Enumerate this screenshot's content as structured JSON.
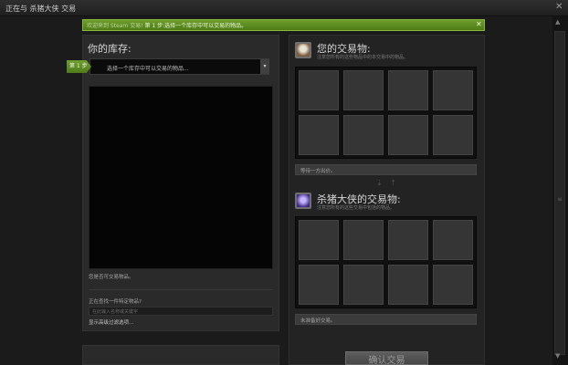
{
  "window": {
    "title": "正在与 杀猪大侠 交易",
    "close_glyph": "✕"
  },
  "notice": {
    "prefix": "欢迎来到 Steam 交易!",
    "text": "第 1 步:选择一个库存中可以交易的物品。",
    "close_glyph": "✕"
  },
  "inventory": {
    "title": "你的库存:",
    "step_badge": "第 1 步",
    "select_label": "选择一个库存中可以交易的物品...",
    "select_arrow": "▾",
    "selected_item_text": "您是否可交易物品。",
    "question": "正在查找一件特定物品?",
    "search_placeholder": "在此输入名称或关键字",
    "filter_link": "显示高级过滤选项..."
  },
  "my_offer": {
    "title": "您的交易物:",
    "subtitle": "注意您所有的这些物品中的本交易中的物品。",
    "status": "等待一方出价。"
  },
  "their_offer": {
    "title": "杀猪大侠的交易物:",
    "subtitle": "注意您所有的这些交易中包括的物品。",
    "status": "未准备好交易。"
  },
  "swap_glyph": "⇣ ⇡",
  "confirm_button": "确认交易",
  "scrollbar": {
    "up_glyph": "▲",
    "down_glyph": "▼",
    "grip_glyph": "≡"
  },
  "colors": {
    "accent_green": "#5f8f24",
    "background": "#1b1b1b",
    "panel": "#2a2a2a",
    "slot": "#353535"
  },
  "icons": {
    "my_avatar": "user-avatar-icon",
    "their_avatar": "partner-avatar-icon",
    "swap": "swap-arrows-icon",
    "close": "close-icon"
  }
}
